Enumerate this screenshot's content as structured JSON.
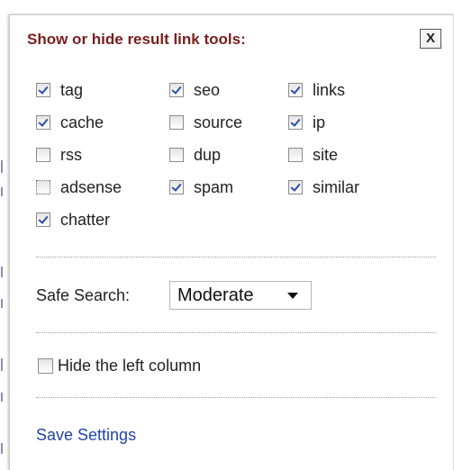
{
  "panel": {
    "title": "Show or hide result link tools:",
    "close_label": "X"
  },
  "tools": [
    {
      "label": "tag",
      "checked": true
    },
    {
      "label": "seo",
      "checked": true
    },
    {
      "label": "links",
      "checked": true
    },
    {
      "label": "cache",
      "checked": true
    },
    {
      "label": "source",
      "checked": false
    },
    {
      "label": "ip",
      "checked": true
    },
    {
      "label": "rss",
      "checked": false
    },
    {
      "label": "dup",
      "checked": false
    },
    {
      "label": "site",
      "checked": false
    },
    {
      "label": "adsense",
      "checked": false
    },
    {
      "label": "spam",
      "checked": true
    },
    {
      "label": "similar",
      "checked": true
    },
    {
      "label": "chatter",
      "checked": true
    }
  ],
  "safe_search": {
    "label": "Safe Search:",
    "selected": "Moderate"
  },
  "hide_left_column": {
    "label": "Hide the left column",
    "checked": false
  },
  "save_settings": {
    "label": "Save Settings"
  },
  "colors": {
    "title": "#7a1e1e",
    "link": "#2244aa",
    "check": "#2a4ea8"
  },
  "icons": {
    "close": "close-icon",
    "dropdown": "chevron-down-icon"
  }
}
